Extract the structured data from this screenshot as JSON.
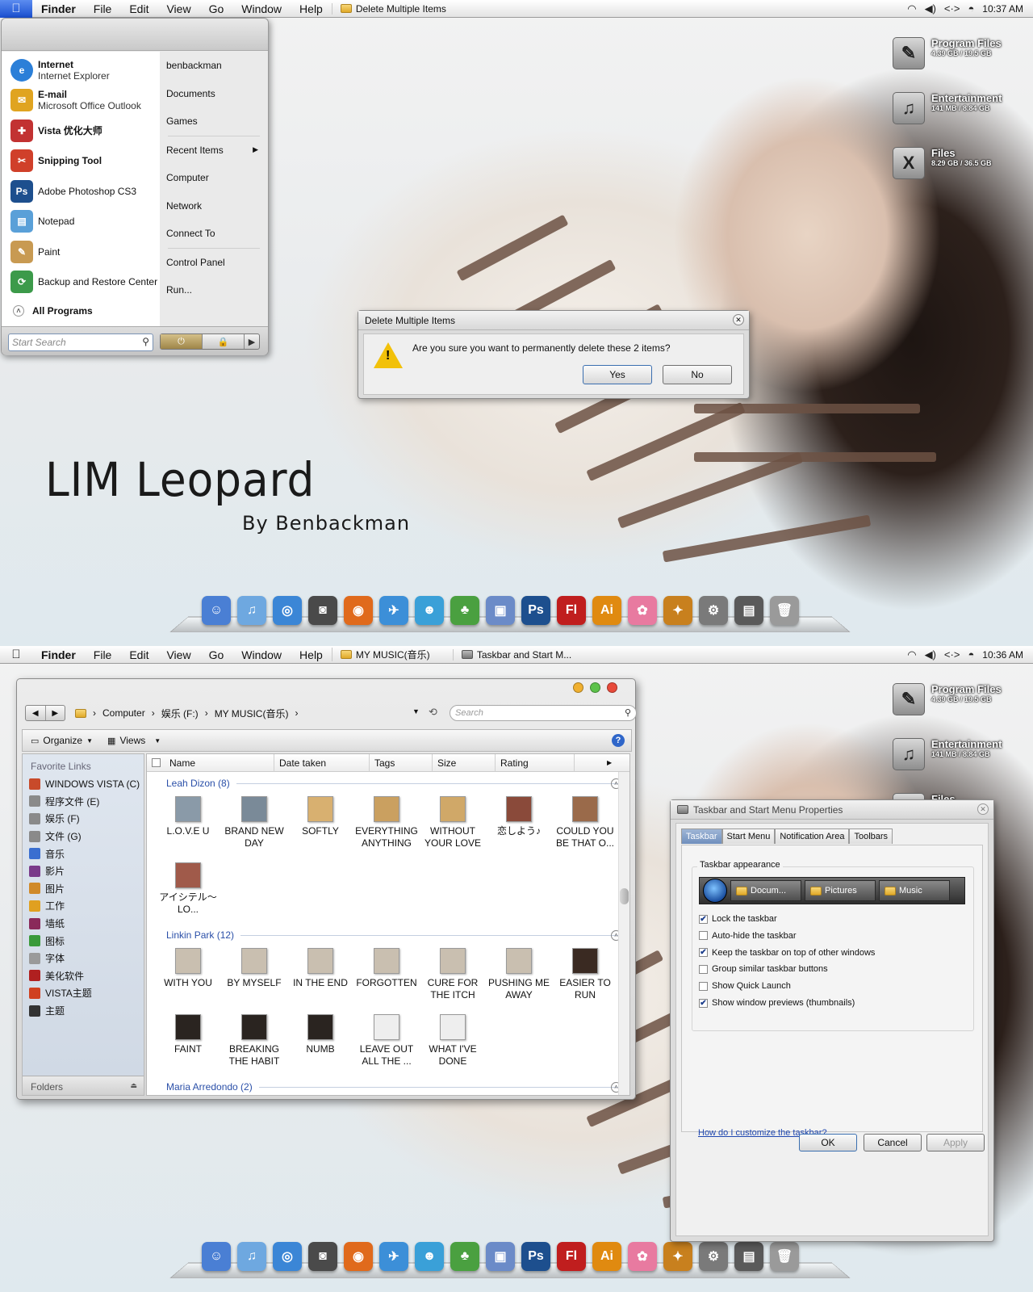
{
  "top": {
    "menubar": {
      "apple": "",
      "app": "Finder",
      "menus": [
        "File",
        "Edit",
        "View",
        "Go",
        "Window",
        "Help"
      ],
      "docs": [
        "Delete Multiple Items"
      ],
      "time": "10:37 AM"
    },
    "start_menu": {
      "programs": [
        {
          "name": "Internet",
          "sub": "Internet Explorer",
          "icon": "internet-explorer-icon",
          "color": "#2b7fd8"
        },
        {
          "name": "E-mail",
          "sub": "Microsoft Office Outlook",
          "icon": "outlook-icon",
          "color": "#e0a420"
        },
        {
          "name": "Vista 优化大师",
          "sub": "",
          "icon": "vista-optimizer-icon",
          "color": "#c23232"
        },
        {
          "name": "Snipping Tool",
          "sub": "",
          "icon": "scissors-icon",
          "color": "#d0402a"
        },
        {
          "label": "Adobe Photoshop CS3",
          "icon": "photoshop-icon",
          "color": "#1d4f8e"
        },
        {
          "label": "Notepad",
          "icon": "notepad-icon",
          "color": "#5aa0d8"
        },
        {
          "label": "Paint",
          "icon": "paint-icon",
          "color": "#c89a52"
        },
        {
          "label": "Backup and Restore Center",
          "icon": "backup-icon",
          "color": "#3c9a4a"
        }
      ],
      "all_programs": "All Programs",
      "links": [
        "benbackman",
        "Documents",
        "Games",
        "Recent Items",
        "Computer",
        "Network",
        "Connect To",
        "Control Panel",
        "Run..."
      ],
      "search_placeholder": "Start Search"
    },
    "dialog": {
      "title": "Delete Multiple Items",
      "message": "Are you sure you want to permanently delete these 2 items?",
      "yes": "Yes",
      "no": "No"
    },
    "wallpaper": {
      "title": "LIM Leopard",
      "subtitle": "By  Benbackman"
    }
  },
  "drives": [
    {
      "name": "Program Files",
      "size": "4.39 GB / 19.5 GB",
      "icon": "program-files-drive-icon",
      "glyph": "✎"
    },
    {
      "name": "Entertainment",
      "size": "141 MB / 8.84 GB",
      "icon": "entertainment-drive-icon",
      "glyph": "♫"
    },
    {
      "name": "Files",
      "size": "8.29 GB / 36.5 GB",
      "icon": "files-drive-icon",
      "glyph": "X"
    }
  ],
  "dock": [
    {
      "icon": "finder-icon",
      "color": "#4a7fd4",
      "glyph": "☺"
    },
    {
      "icon": "itunes-icon",
      "color": "#6ea8e0",
      "glyph": "♫"
    },
    {
      "icon": "safari-icon",
      "color": "#3b86d6",
      "glyph": "◎"
    },
    {
      "icon": "camera-icon",
      "color": "#4a4a4a",
      "glyph": "◙"
    },
    {
      "icon": "firefox-icon",
      "color": "#e06a1c",
      "glyph": "◉"
    },
    {
      "icon": "twitter-bird-icon",
      "color": "#3c8fd8",
      "glyph": "✈"
    },
    {
      "icon": "messenger-icon",
      "color": "#3aa0d8",
      "glyph": "☻"
    },
    {
      "icon": "qq-penguin-icon",
      "color": "#4aa040",
      "glyph": "♣"
    },
    {
      "icon": "preview-icon",
      "color": "#6b8bc8",
      "glyph": "▣"
    },
    {
      "icon": "photoshop-icon",
      "color": "#1d4f8e",
      "glyph": "Ps"
    },
    {
      "icon": "flash-icon",
      "color": "#c01e1e",
      "glyph": "Fl"
    },
    {
      "icon": "illustrator-icon",
      "color": "#e08a10",
      "glyph": "Ai"
    },
    {
      "icon": "chopper-icon",
      "color": "#e87aa0",
      "glyph": "✿"
    },
    {
      "icon": "fox-icon",
      "color": "#c8801e",
      "glyph": "✦"
    },
    {
      "icon": "system-preferences-icon",
      "color": "#7a7a7a",
      "glyph": "⚙"
    },
    {
      "icon": "printer-icon",
      "color": "#5a5a5a",
      "glyph": "▤"
    },
    {
      "icon": "trash-icon",
      "color": "#9a9a9a",
      "glyph": "🗑"
    }
  ],
  "bottom": {
    "menubar": {
      "apple": "",
      "app": "Finder",
      "menus": [
        "File",
        "Edit",
        "View",
        "Go",
        "Window",
        "Help"
      ],
      "docs": [
        "MY MUSIC(音乐)",
        "Taskbar and Start M..."
      ],
      "time": "10:36 AM"
    },
    "explorer": {
      "breadcrumb": [
        "Computer",
        "娱乐 (F:)",
        "MY MUSIC(音乐)"
      ],
      "search_placeholder": "Search",
      "organize": "Organize",
      "views": "Views",
      "favorites_header": "Favorite Links",
      "favorites": [
        {
          "label": "WINDOWS VISTA (C)",
          "color": "#c84a2a"
        },
        {
          "label": "程序文件 (E)",
          "color": "#8a8a8a"
        },
        {
          "label": "娱乐 (F)",
          "color": "#8a8a8a"
        },
        {
          "label": "文件 (G)",
          "color": "#8a8a8a"
        },
        {
          "label": "音乐",
          "color": "#3a6ed0"
        },
        {
          "label": "影片",
          "color": "#7a3a8a"
        },
        {
          "label": "图片",
          "color": "#d08a2a"
        },
        {
          "label": "工作",
          "color": "#e0a020"
        },
        {
          "label": "墙纸",
          "color": "#8a2a5a"
        },
        {
          "label": "图标",
          "color": "#3a9a3a"
        },
        {
          "label": "字体",
          "color": "#9a9a9a"
        },
        {
          "label": "美化软件",
          "color": "#b02020"
        },
        {
          "label": "VISTA主题",
          "color": "#d04020"
        },
        {
          "label": "主题",
          "color": "#333333"
        }
      ],
      "folders": "Folders",
      "columns": [
        "Name",
        "Date taken",
        "Tags",
        "Size",
        "Rating"
      ],
      "groups": [
        {
          "name": "Leah Dizon (8)",
          "items": [
            "L.O.V.E U",
            "BRAND NEW DAY",
            "SOFTLY",
            "EVERYTHING ANYTHING",
            "WITHOUT YOUR LOVE",
            "恋しよう♪",
            "COULD YOU BE THAT O...",
            "アイシテル～LO..."
          ]
        },
        {
          "name": "Linkin Park (12)",
          "items": [
            "WITH YOU",
            "BY MYSELF",
            "IN THE END",
            "FORGOTTEN",
            "CURE FOR THE ITCH",
            "PUSHING ME AWAY",
            "EASIER TO RUN",
            "FAINT",
            "BREAKING THE HABIT",
            "NUMB",
            "LEAVE OUT ALL THE ...",
            "WHAT I'VE DONE"
          ]
        },
        {
          "name": "Maria Arredondo (2)",
          "items": []
        }
      ]
    },
    "properties": {
      "title": "Taskbar and Start Menu Properties",
      "tabs": [
        "Taskbar",
        "Start Menu",
        "Notification Area",
        "Toolbars"
      ],
      "group_label": "Taskbar appearance",
      "preview_buttons": [
        "Docum...",
        "Pictures",
        "Music"
      ],
      "options": [
        {
          "label": "Lock the taskbar",
          "checked": true
        },
        {
          "label": "Auto-hide the taskbar",
          "checked": false
        },
        {
          "label": "Keep the taskbar on top of other windows",
          "checked": true
        },
        {
          "label": "Group similar taskbar buttons",
          "checked": false
        },
        {
          "label": "Show Quick Launch",
          "checked": false
        },
        {
          "label": "Show window previews (thumbnails)",
          "checked": true
        }
      ],
      "help_link": "How do I customize the taskbar?",
      "ok": "OK",
      "cancel": "Cancel",
      "apply": "Apply"
    }
  }
}
